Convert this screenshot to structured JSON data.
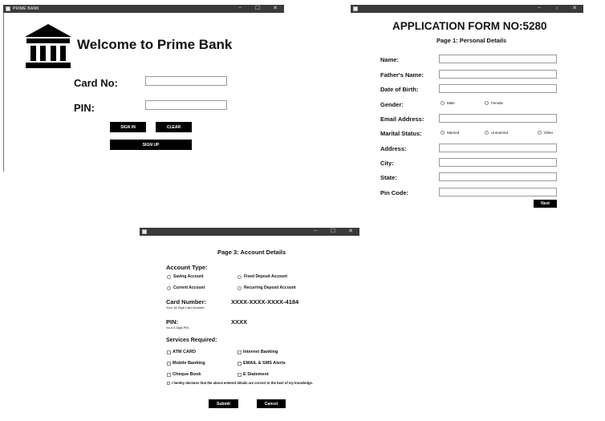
{
  "login": {
    "window_title": "PRIME BANK",
    "controls": [
      "−",
      "☐",
      "✕"
    ],
    "welcome": "Welcome to Prime Bank",
    "card_label": "Card No:",
    "pin_label": "PIN:",
    "sign_in": "SIGN IN",
    "clear": "CLEAR",
    "sign_up": "SIGN UP"
  },
  "form1": {
    "controls": [
      "−",
      "‹",
      "✕"
    ],
    "title": "APPLICATION FORM NO:5280",
    "subtitle": "Page 1: Personal Details",
    "labels": {
      "name": "Name:",
      "father": "Father's Name:",
      "dob": "Date of Birth:",
      "gender": "Gender:",
      "email": "Email Address:",
      "marital": "Marital Status:",
      "address": "Address:",
      "city": "City:",
      "state": "State:",
      "pin": "Pin Code:"
    },
    "gender_options": [
      "Male",
      "Female"
    ],
    "marital_options": [
      "Married",
      "Unmarried",
      "Other"
    ],
    "next": "Next"
  },
  "form3": {
    "controls": [
      "−",
      "☐",
      "✕"
    ],
    "subtitle": "Page 3: Account Details",
    "account_type_label": "Account Type:",
    "account_types": [
      "Saving Account",
      "Fixed Deposit Account",
      "Current Account",
      "Recurring Deposit Account"
    ],
    "card_number_label": "Card Number:",
    "card_number_note": "Your 16 Digit Card Number",
    "card_number_value": "XXXX-XXXX-XXXX-4184",
    "pin_label": "PIN:",
    "pin_note": "Your 4 Digit PIN",
    "pin_value": "XXXX",
    "services_label": "Services Required:",
    "services": [
      "ATM CARD",
      "Internet Banking",
      "Mobile Banking",
      "EMAIL & SMS Alerts",
      "Cheque Book",
      "E Statement"
    ],
    "declaration": "I hereby declares that the above entered details are correct to the best of my knowledge.",
    "submit": "Submit",
    "cancel": "Cancel"
  }
}
